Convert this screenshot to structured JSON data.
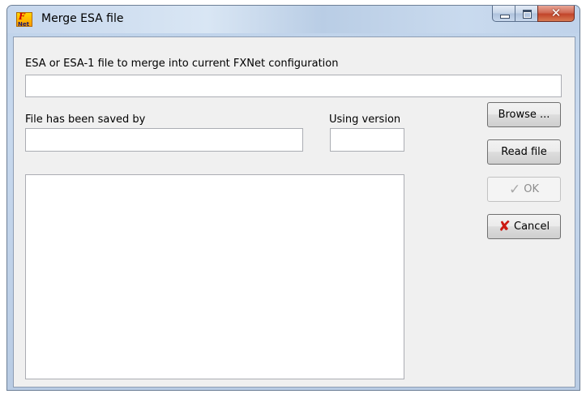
{
  "window": {
    "title": "Merge ESA file",
    "icon": "fxnet-app-icon",
    "icon_text_top": "F",
    "icon_text_bottom": "Net"
  },
  "caption_buttons": {
    "minimize": "minimize-icon",
    "maximize": "maximize-icon",
    "close_glyph": "✕"
  },
  "form": {
    "file_label": "ESA or ESA-1 file to merge into current FXNet configuration",
    "file_value": "",
    "saved_by_label": "File has been saved by",
    "saved_by_value": "",
    "version_label": "Using version",
    "version_value": ""
  },
  "buttons": {
    "browse": "Browse ...",
    "read_file": "Read file",
    "ok": "OK",
    "cancel": "Cancel"
  },
  "icons": {
    "ok": "check-icon",
    "cancel": "x-icon"
  },
  "colors": {
    "cancel_icon": "#cc1a12",
    "titlebar": "#c5d6ec",
    "client_bg": "#f0f0f0"
  }
}
